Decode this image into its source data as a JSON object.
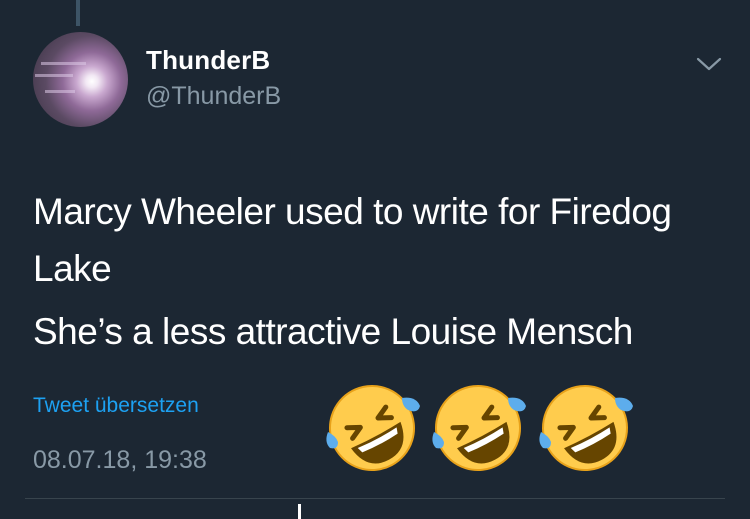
{
  "tweet": {
    "display_name": "ThunderB",
    "handle": "@ThunderB",
    "text_lines": [
      "Marcy Wheeler used to write for Firedog Lake",
      "She’s a less attractive Louise Mensch"
    ],
    "translate_label": "Tweet übersetzen",
    "timestamp": "08.07.18, 19:38",
    "emojis": [
      "rolling-on-floor-laughing",
      "rolling-on-floor-laughing",
      "rolling-on-floor-laughing"
    ]
  },
  "icons": {
    "menu": "chevron-down-icon"
  },
  "colors": {
    "background": "#1c2733",
    "text": "#ffffff",
    "secondary_text": "#8899a6",
    "link": "#1da1f2",
    "emoji_face": "#ffcc4d"
  }
}
